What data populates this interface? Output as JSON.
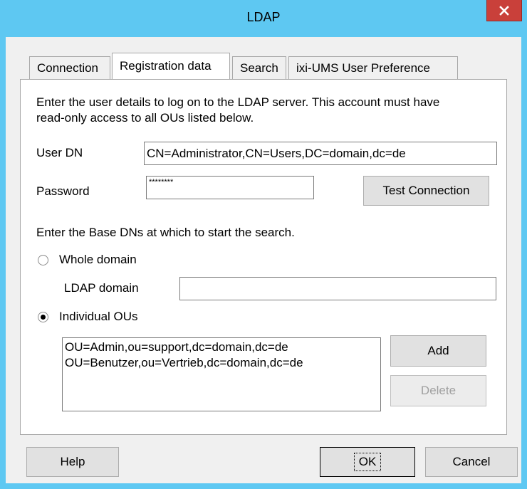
{
  "window": {
    "title": "LDAP"
  },
  "tabs": [
    {
      "label": "Connection"
    },
    {
      "label": "Registration data"
    },
    {
      "label": "Search"
    },
    {
      "label": "ixi-UMS User Preference"
    }
  ],
  "panel": {
    "intro_line1": "Enter the user details to log on to the LDAP server. This account must have",
    "intro_line2": "read-only access to all OUs listed below.",
    "user_dn_label": "User DN",
    "user_dn_value": "CN=Administrator,CN=Users,DC=domain,dc=de",
    "password_label": "Password",
    "password_value": "********",
    "test_connection_label": "Test Connection",
    "base_dn_text": "Enter the Base DNs at which to start the search.",
    "whole_domain_label": "Whole domain",
    "ldap_domain_label": "LDAP domain",
    "ldap_domain_value": "",
    "individual_ous_label": "Individual OUs",
    "whole_domain_selected": false,
    "individual_ous_selected": true,
    "ou_list": [
      "OU=Admin,ou=support,dc=domain,dc=de",
      "OU=Benutzer,ou=Vertrieb,dc=domain,dc=de"
    ],
    "add_label": "Add",
    "delete_label": "Delete"
  },
  "footer": {
    "help_label": "Help",
    "ok_label": "OK",
    "cancel_label": "Cancel"
  },
  "colors": {
    "titlebar": "#5ec8f2",
    "close_button": "#c9403a",
    "dialog_bg": "#f0f0f0"
  },
  "icons": {
    "close": "close-icon"
  }
}
